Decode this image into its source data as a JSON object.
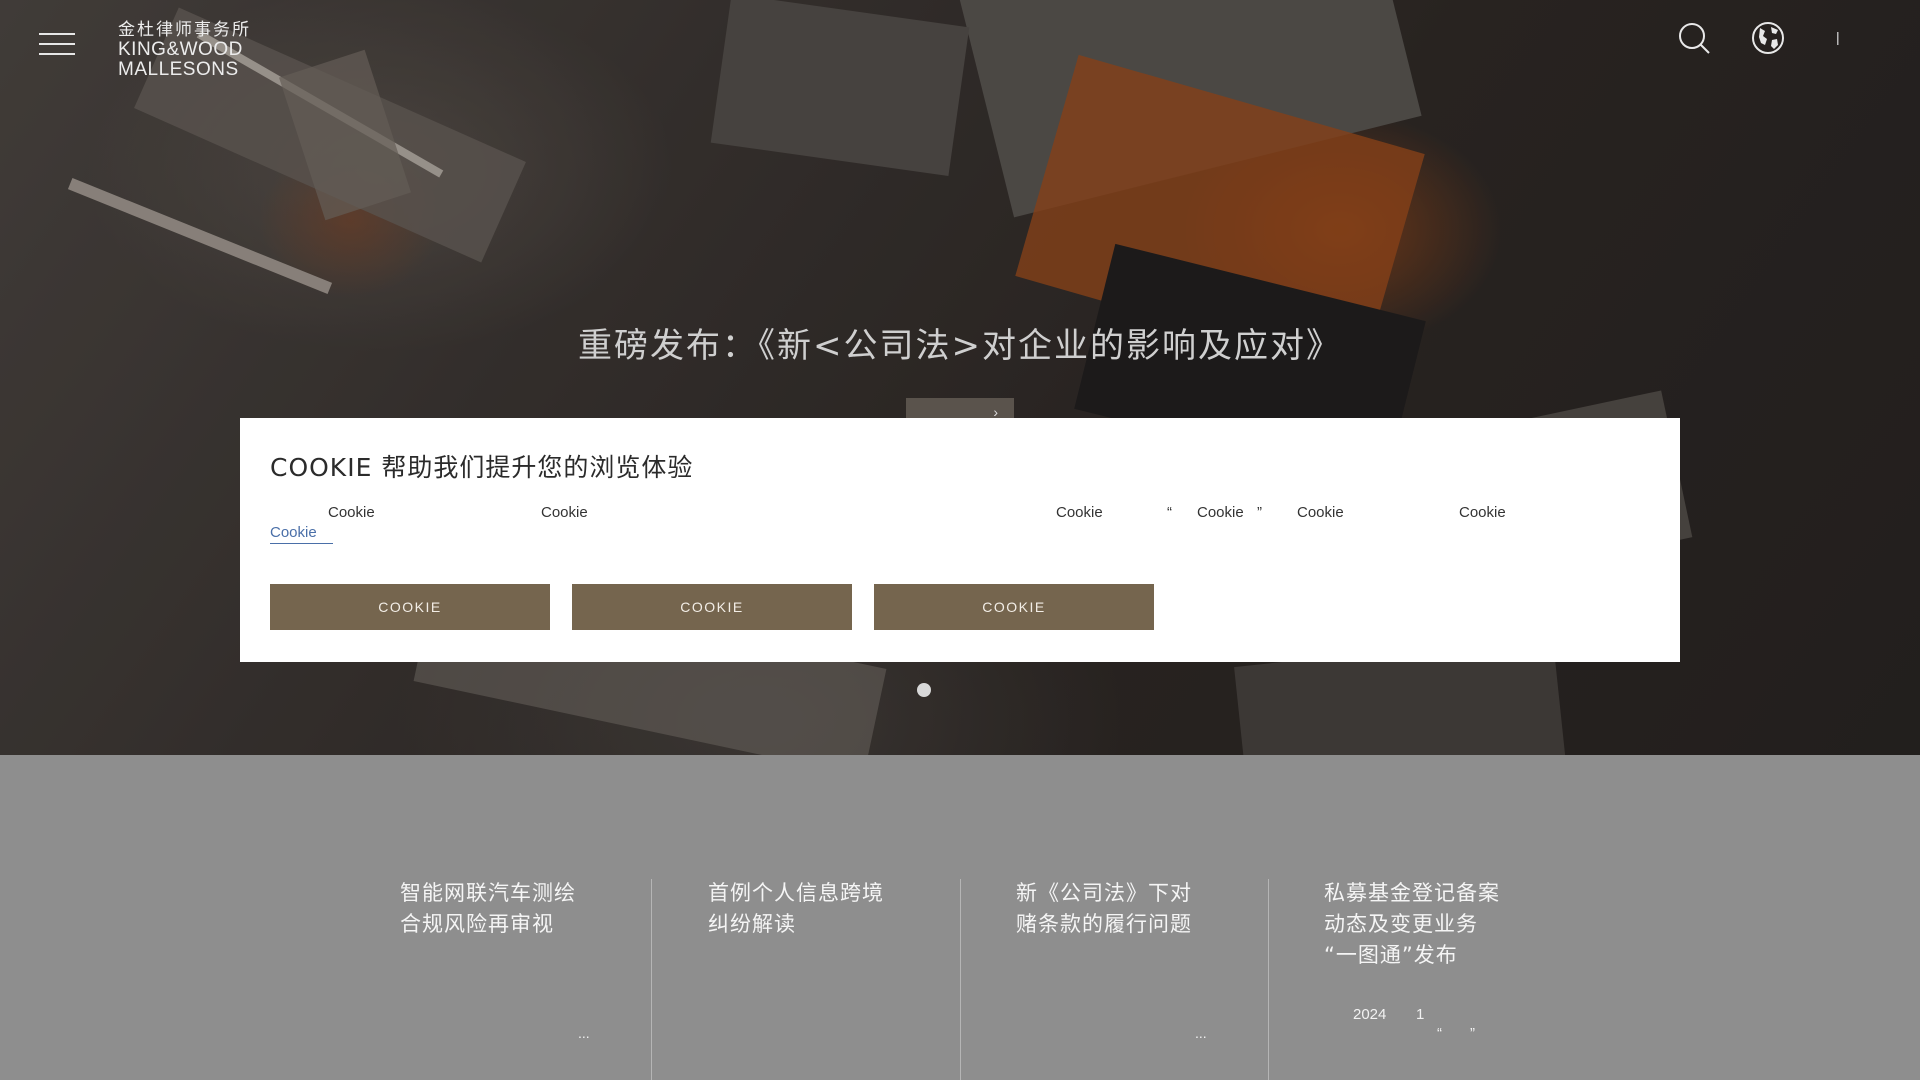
{
  "header": {
    "logo": {
      "cn": "金杜律师事务所",
      "en_line1": "KING&WOOD",
      "en_line2": "MALLESONS"
    },
    "language_separator": "|",
    "icons": [
      "menu-icon",
      "search-icon",
      "globe-icon"
    ]
  },
  "hero": {
    "title": "重磅发布：《新<公司法>对企业的影响及应对》",
    "button_label": "›"
  },
  "cookie_dialog": {
    "title": "COOKIE 帮助我们提升您的浏览体验",
    "body_words": [
      "Cookie",
      "Cookie",
      "Cookie",
      "“",
      "Cookie",
      "”",
      "Cookie",
      "Cookie"
    ],
    "link_text": "Cookie",
    "buttons": [
      "COOKIE",
      "COOKIE",
      "COOKIE"
    ]
  },
  "news": {
    "items": [
      {
        "title_lines": [
          "智能网联汽车测绘",
          "合规风险再审视"
        ],
        "more": "..."
      },
      {
        "title_lines": [
          "首例个人信息跨境",
          "纠纷解读"
        ]
      },
      {
        "title_lines": [
          "新《公司法》下对",
          "赌条款的履行问题"
        ],
        "more": "..."
      },
      {
        "title_lines": [
          "私募基金登记备案",
          "动态及变更业务",
          "“一图通”发布"
        ],
        "meta_year": "2024",
        "meta_month": "1",
        "meta_quote_open": "“",
        "meta_quote_close": "”"
      }
    ]
  },
  "colors": {
    "cookie_button": "#75654e",
    "link": "#4a6fa8",
    "news_background": "#8e8e8e"
  }
}
